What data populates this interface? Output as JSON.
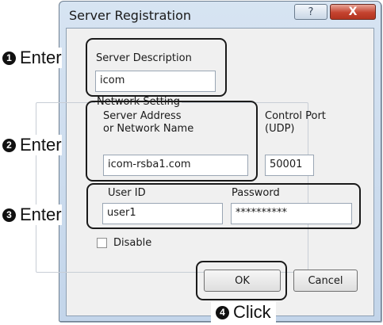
{
  "dialog": {
    "title": "Server Registration",
    "help_label": "?",
    "close_label": "X"
  },
  "server_description": {
    "label": "Server Description",
    "value": "icom"
  },
  "network_setting": {
    "legend": "Network Setting",
    "address_label_line1": "Server Address",
    "address_label_line2": "or Network Name",
    "address_value": "icom-rsba1.com",
    "port_label_line1": "Control Port",
    "port_label_line2": "(UDP)",
    "port_value": "50001"
  },
  "credentials": {
    "user_id_label": "User ID",
    "user_id_value": "user1",
    "password_label": "Password",
    "password_value": "**********"
  },
  "disable": {
    "label": "Disable",
    "checked": false
  },
  "buttons": {
    "ok_label": "OK",
    "cancel_label": "Cancel"
  },
  "callouts": [
    {
      "number": "❶",
      "text": "Enter"
    },
    {
      "number": "❷",
      "text": "Enter"
    },
    {
      "number": "❸",
      "text": "Enter"
    },
    {
      "number": "❹",
      "text": "Click"
    }
  ]
}
